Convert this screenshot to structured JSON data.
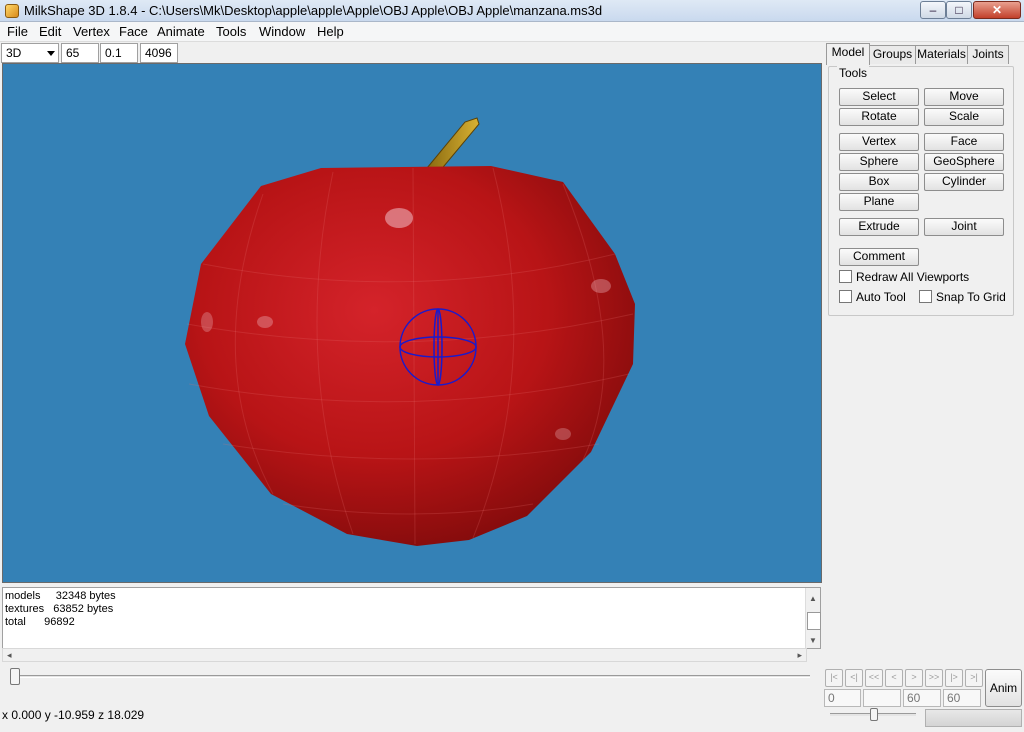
{
  "window": {
    "title": "MilkShape 3D 1.8.4 - C:\\Users\\Mk\\Desktop\\apple\\apple\\Apple\\OBJ Apple\\OBJ Apple\\manzana.ms3d",
    "minimize": "–",
    "maximize": "□",
    "close": "✕"
  },
  "menu": [
    "File",
    "Edit",
    "Vertex",
    "Face",
    "Animate",
    "Tools",
    "Window",
    "Help"
  ],
  "toolbar": {
    "view_mode": "3D",
    "fov": "65",
    "near": "0.1",
    "far": "4096"
  },
  "log": {
    "lines": [
      "models     32348 bytes",
      "textures   63852 bytes",
      "total      96892"
    ]
  },
  "status": {
    "coords": "x 0.000 y -10.959 z 18.029"
  },
  "tabs": [
    "Model",
    "Groups",
    "Materials",
    "Joints"
  ],
  "tools": {
    "legend": "Tools",
    "buttons": [
      "Select",
      "Move",
      "Rotate",
      "Scale",
      "Vertex",
      "Face",
      "Sphere",
      "GeoSphere",
      "Box",
      "Cylinder",
      "Plane",
      "Extrude",
      "Joint",
      "Comment"
    ],
    "checkboxes": [
      "Redraw All Viewports",
      "Auto Tool",
      "Snap To Grid"
    ]
  },
  "animation": {
    "nav": [
      "|<",
      "<|",
      "<<",
      "<",
      ">",
      ">>",
      "|>",
      ">|"
    ],
    "fields": [
      "0",
      "",
      "60",
      "60"
    ],
    "anim_label": "Anim"
  },
  "colors": {
    "viewport_bg": "#3481b6",
    "apple_red": "#b81416",
    "joint_blue": "#1a1acc"
  }
}
